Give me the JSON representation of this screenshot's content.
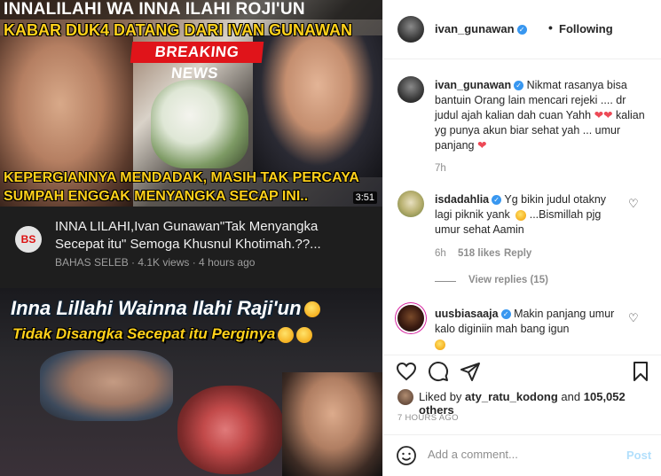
{
  "media": {
    "thumb1": {
      "title": "INNALILAHI WA INNA ILAHI ROJI'UN",
      "subtitle": "KABAR DUK4 DATANG DARI IVAN GUNAWAN",
      "breaking": "BREAKING NEWS",
      "caption_line1": "KEPERGIANNYA MENDADAK, MASIH TAK PERCAYA",
      "caption_line2": "SUMPAH ENGGAK MENYANGKA SECAP INI..",
      "duration": "3:51"
    },
    "video": {
      "channel_badge": "BS",
      "title": "INNA LILAHI,Ivan Gunawan\"Tak Menyangka Secepat itu\" Semoga Khusnul Khotimah.??...",
      "meta": "BAHAS SELEB · 4.1K views · 4 hours ago"
    },
    "thumb2": {
      "title": "Inna Lillahi Wainna Ilahi Raji'un",
      "subtitle": "Tidak Disangka Secepat itu Perginya"
    }
  },
  "header": {
    "username": "ivan_gunawan",
    "separator": "•",
    "follow_status": "Following"
  },
  "comments": [
    {
      "username": "ivan_gunawan",
      "text": "Nikmat rasanya bisa bantuin Orang lain mencari rejeki .... dr judul ajah kalian dah cuan Yahh",
      "text2": "kalian yg punya akun biar sehat yah ... umur panjang",
      "time": "7h"
    },
    {
      "username": "isdadahlia",
      "text": "Yg bikin judul otakny lagi piknik yank",
      "text2": "...Bismillah pjg umur sehat Aamin",
      "time": "6h",
      "likes": "518 likes",
      "reply": "Reply",
      "view_replies": "View replies (15)"
    },
    {
      "username": "uusbiasaaja",
      "text": "Makin panjang umur kalo diginiin mah bang igun"
    }
  ],
  "actions": {
    "liked_prefix": "Liked by",
    "liked_user": "aty_ratu_kodong",
    "liked_and": "and",
    "liked_count": "105,052 others",
    "time_ago": "7 HOURS AGO"
  },
  "add_comment": {
    "placeholder": "Add a comment...",
    "post_label": "Post"
  },
  "colors": {
    "verified": "#3897f0",
    "heart": "#ed4956",
    "post_disabled": "#b2dffc",
    "meta_gray": "#8e8e8e"
  }
}
